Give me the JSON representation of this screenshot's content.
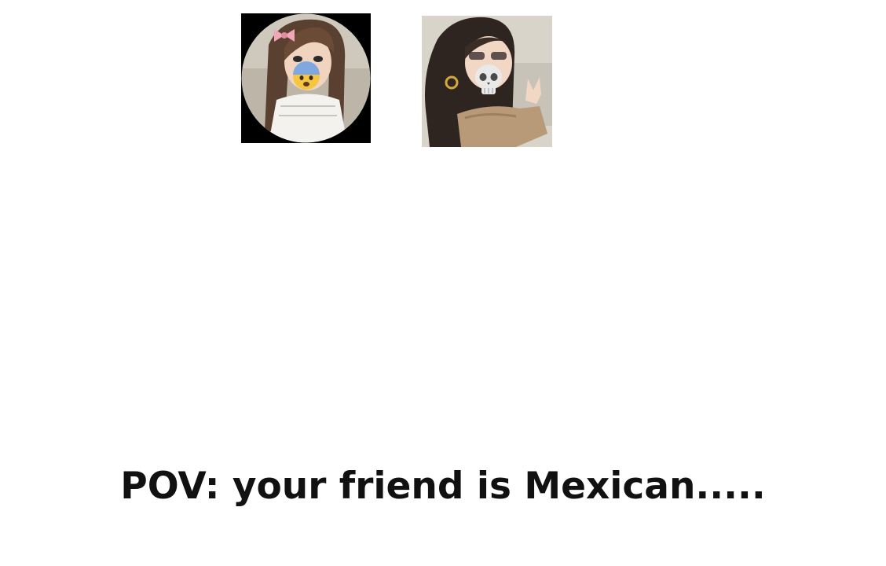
{
  "avatars": [
    {
      "name": "left-avatar",
      "overlay_emoji": "fearful-cold-face",
      "accessory": "pink-bow",
      "frame": "circle-on-black"
    },
    {
      "name": "right-avatar",
      "overlay_emoji": "skull",
      "accessory": "hoop-earring",
      "frame": "square"
    }
  ],
  "caption": {
    "text": "POV: your friend is Mexican....."
  },
  "colors": {
    "background": "#ffffff",
    "caption_text": "#111111",
    "left_frame": "#000000"
  }
}
